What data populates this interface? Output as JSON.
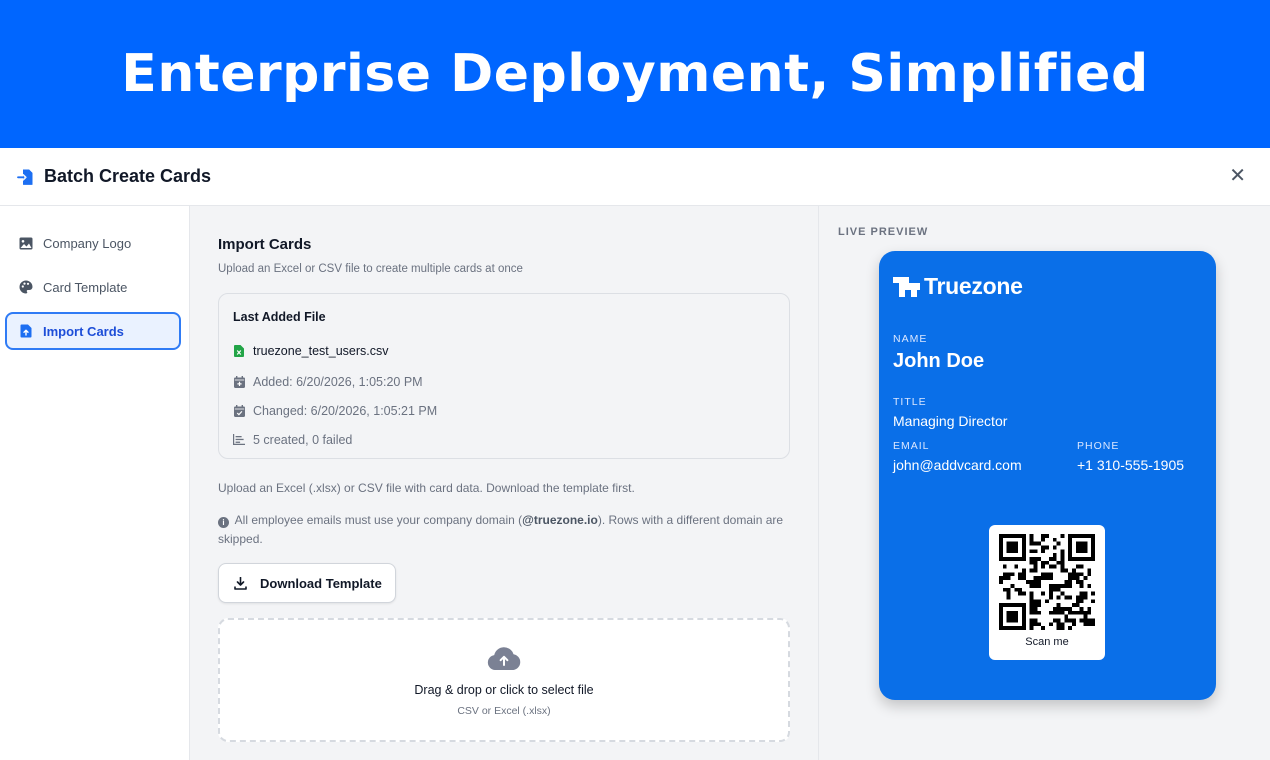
{
  "banner": {
    "title": "Enterprise Deployment, Simplified"
  },
  "header": {
    "title": "Batch Create Cards",
    "close_label": "✕"
  },
  "sidebar": {
    "items": [
      {
        "label": "Company Logo",
        "icon": "image-icon",
        "active": false
      },
      {
        "label": "Card Template",
        "icon": "palette-icon",
        "active": false
      },
      {
        "label": "Import Cards",
        "icon": "file-upload-icon",
        "active": true
      }
    ]
  },
  "main": {
    "title": "Import Cards",
    "subtitle": "Upload an Excel or CSV file to create multiple cards at once",
    "last_file": {
      "heading": "Last Added File",
      "filename": "truezone_test_users.csv",
      "added": "Added: 6/20/2026, 1:05:20 PM",
      "changed": "Changed: 6/20/2026, 1:05:21 PM",
      "result": "5 created, 0 failed"
    },
    "help_text": "Upload an Excel (.xlsx) or CSV file with card data. Download the template first.",
    "notice": {
      "before": "All employee emails must use your company domain (",
      "domain": "@truezone.io",
      "after": "). Rows with a different domain are skipped."
    },
    "download_button": "Download Template",
    "dropzone": {
      "title": "Drag & drop or click to select file",
      "subtitle": "CSV or Excel (.xlsx)"
    }
  },
  "preview": {
    "label": "LIVE PREVIEW",
    "card": {
      "brand": "Truezone",
      "name_label": "NAME",
      "name": "John Doe",
      "title_label": "TITLE",
      "title": "Managing Director",
      "email_label": "EMAIL",
      "email": "john@addvcard.com",
      "phone_label": "PHONE",
      "phone": "+1 310-555-1905",
      "qr_caption": "Scan me",
      "background_color": "#0a6fe8"
    }
  },
  "colors": {
    "banner": "#0066ff",
    "accent": "#2f7bf5",
    "active_bg": "#eaf2ff"
  }
}
